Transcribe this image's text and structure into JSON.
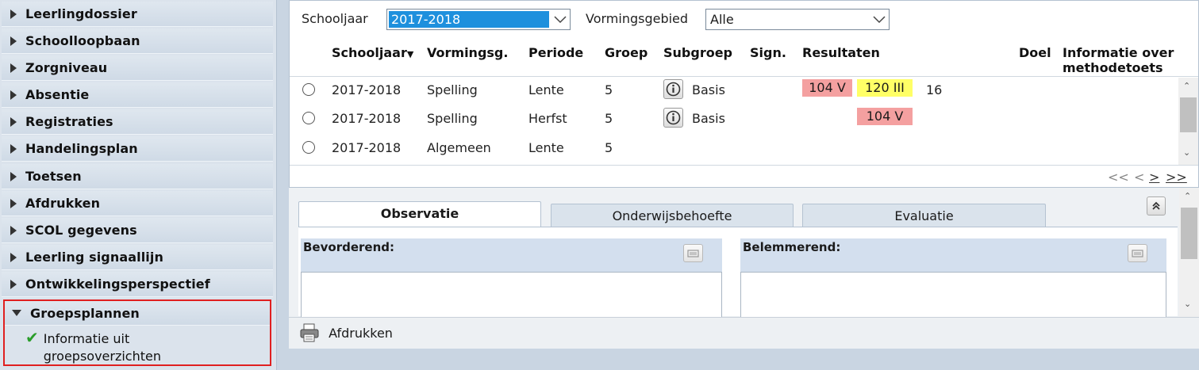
{
  "sidebar": {
    "items": [
      {
        "label": "Leerlingdossier"
      },
      {
        "label": "Schoolloopbaan"
      },
      {
        "label": "Zorgniveau"
      },
      {
        "label": "Absentie"
      },
      {
        "label": "Registraties"
      },
      {
        "label": "Handelingsplan"
      },
      {
        "label": "Toetsen"
      },
      {
        "label": "Afdrukken"
      },
      {
        "label": "SCOL gegevens"
      },
      {
        "label": "Leerling signaallijn"
      },
      {
        "label": "Ontwikkelingsperspectief"
      }
    ],
    "expanded": {
      "label": "Groepsplannen",
      "sub_line1": "Informatie uit",
      "sub_line2": "groepsoverzichten"
    }
  },
  "filters": {
    "schooljaar_label": "Schooljaar",
    "schooljaar_value": "2017-2018",
    "vormingsgebied_label": "Vormingsgebied",
    "vormingsgebied_value": "Alle"
  },
  "table": {
    "headers": {
      "schooljaar": "Schooljaar",
      "vormingsg": "Vormingsg.",
      "periode": "Periode",
      "groep": "Groep",
      "subgroep": "Subgroep",
      "sign": "Sign.",
      "resultaten": "Resultaten",
      "doel": "Doel",
      "info1": "Informatie over",
      "info2": "methodetoets"
    },
    "rows": [
      {
        "schooljaar": "2017-2018",
        "vormingsg": "Spelling",
        "periode": "Lente",
        "groep": "5",
        "subgroep": "Basis",
        "res1": "104 V",
        "res2": "120 III",
        "extra": "16"
      },
      {
        "schooljaar": "2017-2018",
        "vormingsg": "Spelling",
        "periode": "Herfst",
        "groep": "5",
        "subgroep": "Basis",
        "res2": "104 V"
      },
      {
        "schooljaar": "2017-2018",
        "vormingsg": "Algemeen",
        "periode": "Lente",
        "groep": "5"
      }
    ]
  },
  "pager": {
    "first": "<<",
    "prev": "<",
    "next": ">",
    "last": ">>"
  },
  "tabs": {
    "observatie": "Observatie",
    "onderwijsbehoefte": "Onderwijsbehoefte",
    "evaluatie": "Evaluatie"
  },
  "boxes": {
    "left": "Bevorderend:",
    "right": "Belemmerend:"
  },
  "bottom": {
    "print_label": "Afdrukken"
  },
  "colors": {
    "red_result": "#f4a0a0",
    "yellow_result": "#ffff66",
    "selected": "#1e90dd",
    "highlight_border": "#e02020"
  }
}
